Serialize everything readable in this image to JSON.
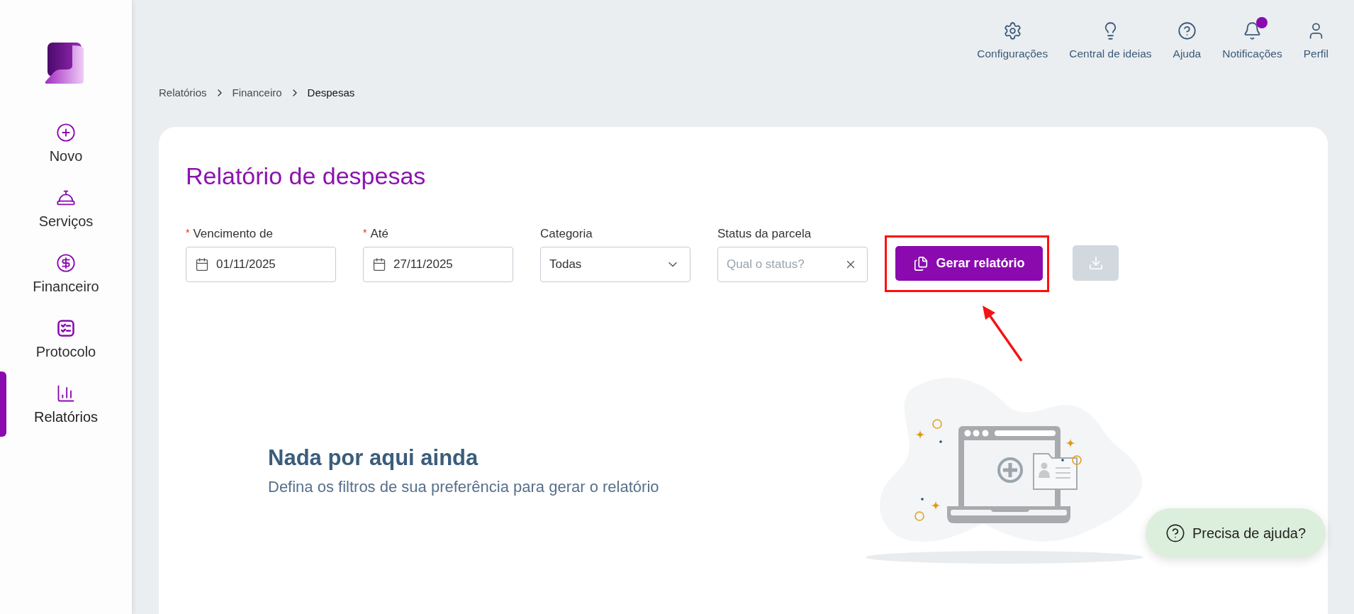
{
  "sidebar": {
    "items": [
      {
        "label": "Novo",
        "selected": false
      },
      {
        "label": "Serviços",
        "selected": false
      },
      {
        "label": "Financeiro",
        "selected": false
      },
      {
        "label": "Protocolo",
        "selected": false
      },
      {
        "label": "Relatórios",
        "selected": true
      }
    ]
  },
  "topbar": {
    "items": [
      {
        "label": "Configurações",
        "unread": false
      },
      {
        "label": "Central de ideias",
        "unread": false
      },
      {
        "label": "Ajuda",
        "unread": false
      },
      {
        "label": "Notificações",
        "unread": true
      },
      {
        "label": "Perfil",
        "unread": false
      }
    ]
  },
  "breadcrumb": [
    {
      "label": "Relatórios",
      "current": false
    },
    {
      "label": "Financeiro",
      "current": false
    },
    {
      "label": "Despesas",
      "current": true
    }
  ],
  "card": {
    "title": "Relatório de despesas",
    "filters": [
      {
        "kind": "date",
        "label": "Vencimento de",
        "required_mark": "*",
        "value": "01/11/2025"
      },
      {
        "kind": "date",
        "label": "Até",
        "required_mark": "*",
        "value": "27/11/2025"
      },
      {
        "kind": "select",
        "label": "Categoria",
        "value": "Todas"
      },
      {
        "kind": "search",
        "label": "Status da parcela",
        "placeholder": "Qual o status?"
      }
    ],
    "generate_button": {
      "label": "Gerar relatório",
      "highlighted": true
    },
    "download_button": {
      "disabled": true
    },
    "empty_state": {
      "heading": "Nada por aqui ainda",
      "text": "Defina os filtros de sua preferência para gerar o relatório"
    }
  },
  "help_button": {
    "label": "Precisa de ajuda?"
  }
}
